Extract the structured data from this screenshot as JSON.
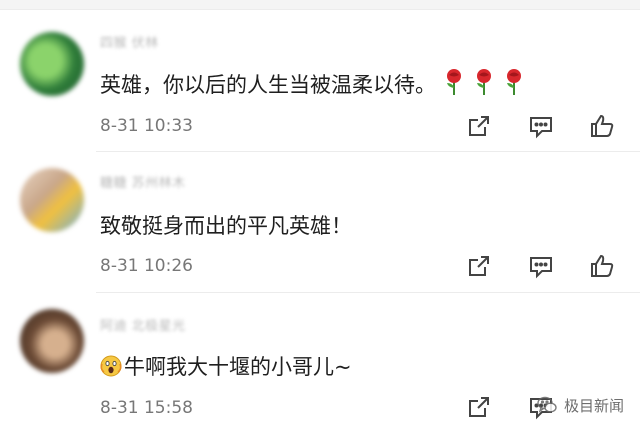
{
  "comments": [
    {
      "username": "四猴 伏林",
      "text": "英雄，你以后的人生当被温柔以待。",
      "trailing_emoji": [
        "rose-icon",
        "rose-icon",
        "rose-icon"
      ],
      "time": "8-31 10:33",
      "avatar_colors": [
        "#2f7d3a",
        "#8bd36b",
        "#1d5a2a"
      ]
    },
    {
      "username": "糖糖 苏州林木",
      "text": "致敬挺身而出的平凡英雄！",
      "trailing_emoji": [],
      "time": "8-31 10:26",
      "avatar_colors": [
        "#c9a78a",
        "#f0c040",
        "#6fb0d8"
      ]
    },
    {
      "username": "阿迪 北极星光",
      "text": "牛啊我大十堰的小哥儿~",
      "leading_emoji": "scream-emoji-icon",
      "time": "8-31 15:58",
      "avatar_colors": [
        "#6b4a35",
        "#d6b08e",
        "#3a2a20"
      ]
    }
  ],
  "actions": [
    "share-icon",
    "reply-icon",
    "like-icon"
  ],
  "watermark": {
    "text": "极目新闻",
    "icon": "wechat-icon"
  }
}
